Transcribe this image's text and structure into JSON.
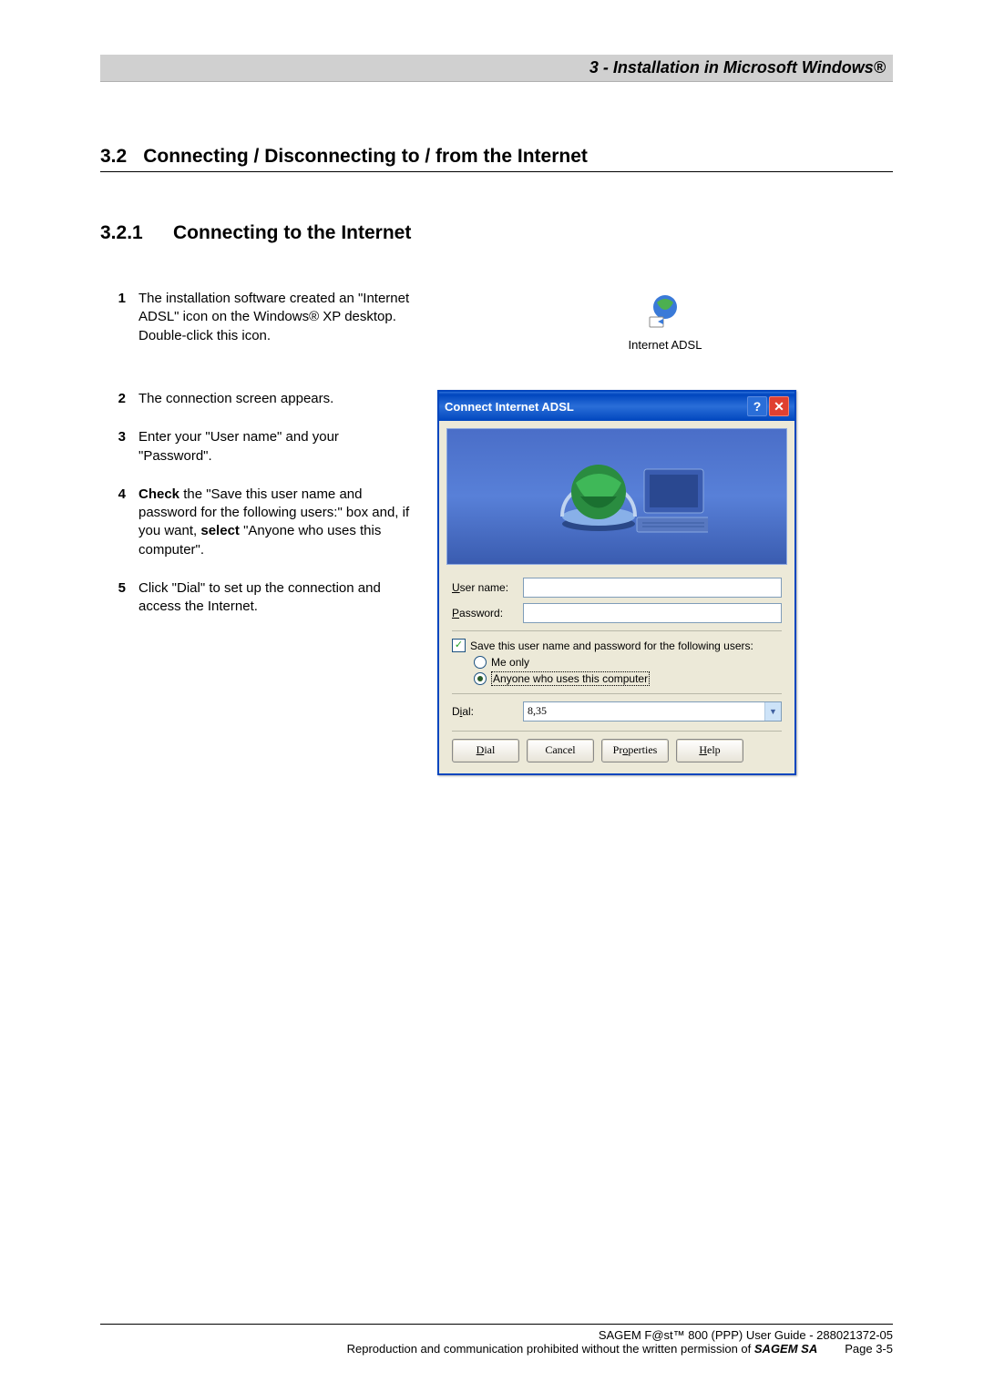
{
  "header": {
    "chapter": "3 - Installation in Microsoft Windows®"
  },
  "section": {
    "number": "3.2",
    "title": "Connecting / Disconnecting to / from the Internet"
  },
  "subsection": {
    "number": "3.2.1",
    "title": "Connecting to the Internet"
  },
  "steps": [
    {
      "n": "1",
      "html": "The installation software created an \"Internet ADSL\" icon on the Windows® XP desktop.  Double-click this icon."
    },
    {
      "n": "2",
      "html": "The connection screen appears."
    },
    {
      "n": "3",
      "html": "Enter your \"User name\" and your \"Password\"."
    },
    {
      "n": "4",
      "html": "<b>Check</b> the \"Save this user name and password for the following users:\" box and, if you want, <b>select</b> \"Anyone who uses this computer\"."
    },
    {
      "n": "5",
      "html": "Click \"Dial\" to set up the connection and access the Internet."
    }
  ],
  "desktop_icon": {
    "label": "Internet ADSL"
  },
  "dialog": {
    "title": "Connect Internet ADSL",
    "username_label": "User name:",
    "password_label": "Password:",
    "save_check_label": "Save this user name and password for the following users:",
    "radio_me_only": "Me only",
    "radio_anyone": "Anyone who uses this computer",
    "dial_label": "Dial:",
    "dial_value": "8,35",
    "buttons": {
      "dial": "Dial",
      "cancel": "Cancel",
      "properties": "Properties",
      "help": "Help"
    }
  },
  "footer": {
    "line1": "SAGEM F@st™ 800 (PPP) User Guide - 288021372-05",
    "line2_prefix": "Reproduction and communication prohibited without the written permission of ",
    "brand": "SAGEM SA",
    "page": "Page 3-5"
  }
}
